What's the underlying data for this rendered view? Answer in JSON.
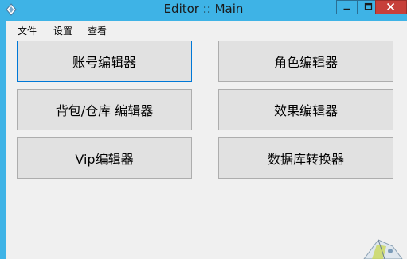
{
  "window": {
    "title": "Editor :: Main",
    "icon": "editor-app-icon",
    "controls": [
      "minimize-icon",
      "maximize-icon",
      "close-icon"
    ]
  },
  "menu": {
    "file": "文件",
    "settings": "设置",
    "view": "查看"
  },
  "buttons": {
    "account_editor": "账号编辑器",
    "role_editor": "角色编辑器",
    "bag_warehouse_editor": "背包/仓库 编辑器",
    "effect_editor": "效果编辑器",
    "vip_editor": "Vip编辑器",
    "db_converter": "数据库转换器"
  },
  "colors": {
    "titlebar": "#3eb3e6",
    "close_button": "#c7403a",
    "client_bg": "#f0f0f0",
    "button_bg": "#e1e1e1",
    "focus_border": "#0078d7"
  }
}
